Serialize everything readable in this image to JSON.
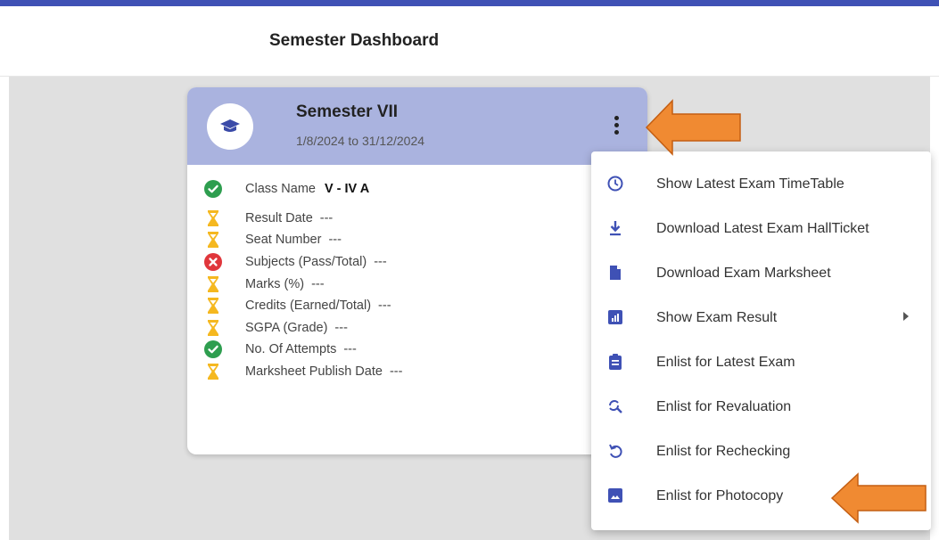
{
  "header": {
    "title": "Semester Dashboard"
  },
  "colors": {
    "accent": "#3f51b5",
    "card_header": "#aab3df",
    "success": "#2e9e4f",
    "pending": "#f5b820",
    "error": "#e0363b",
    "arrow": "#f08a32"
  },
  "card": {
    "title": "Semester VII",
    "date_range": "1/8/2024 to 31/12/2024",
    "icon": "graduation-cap-icon",
    "rows": [
      {
        "label": "Class Name",
        "value": "V - IV A",
        "status": "success"
      },
      {
        "label": "Result Date",
        "value": "---",
        "status": "pending"
      },
      {
        "label": "Seat Number",
        "value": "---",
        "status": "pending"
      },
      {
        "label": "Subjects (Pass/Total)",
        "value": "---",
        "status": "error"
      },
      {
        "label": "Marks (%)",
        "value": "---",
        "status": "pending"
      },
      {
        "label": "Credits (Earned/Total)",
        "value": "---",
        "status": "pending"
      },
      {
        "label": "SGPA (Grade)",
        "value": "---",
        "status": "pending"
      },
      {
        "label": "No. Of Attempts",
        "value": "---",
        "status": "success"
      },
      {
        "label": "Marksheet Publish Date",
        "value": "---",
        "status": "pending"
      }
    ]
  },
  "menu": {
    "items": [
      {
        "label": "Show Latest Exam TimeTable",
        "icon": "clock-icon"
      },
      {
        "label": "Download Latest Exam HallTicket",
        "icon": "download-icon"
      },
      {
        "label": "Download Exam Marksheet",
        "icon": "document-icon"
      },
      {
        "label": "Show Exam Result",
        "icon": "chart-icon",
        "submenu": true
      },
      {
        "label": "Enlist for Latest Exam",
        "icon": "clipboard-icon"
      },
      {
        "label": "Enlist for Revaluation",
        "icon": "search-refresh-icon"
      },
      {
        "label": "Enlist for Rechecking",
        "icon": "undo-icon"
      },
      {
        "label": "Enlist for Photocopy",
        "icon": "image-icon"
      }
    ]
  }
}
